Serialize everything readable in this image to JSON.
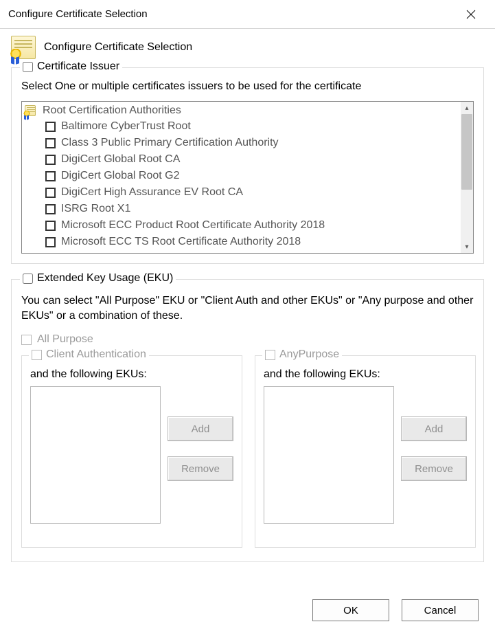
{
  "window": {
    "title": "Configure Certificate Selection"
  },
  "header": {
    "title": "Configure Certificate Selection"
  },
  "issuer_group": {
    "legend": "Certificate Issuer",
    "description": "Select One or multiple certificates issuers to be used for the certificate",
    "root_label": "Root Certification Authorities",
    "items": [
      {
        "label": "Baltimore CyberTrust Root",
        "checked": false
      },
      {
        "label": "Class 3 Public Primary Certification Authority",
        "checked": false
      },
      {
        "label": "DigiCert Global Root CA",
        "checked": false
      },
      {
        "label": "DigiCert Global Root G2",
        "checked": false
      },
      {
        "label": "DigiCert High Assurance EV Root CA",
        "checked": false
      },
      {
        "label": "ISRG Root X1",
        "checked": false
      },
      {
        "label": "Microsoft ECC Product Root Certificate Authority 2018",
        "checked": false
      },
      {
        "label": "Microsoft ECC TS Root Certificate Authority 2018",
        "checked": false
      }
    ]
  },
  "eku_group": {
    "legend": "Extended Key Usage (EKU)",
    "description": "You can select \"All Purpose\" EKU or \"Client Auth and other EKUs\" or \"Any purpose and other EKUs\" or a combination of these.",
    "all_purpose_label": "All Purpose",
    "left": {
      "legend": "Client Authentication",
      "subtitle": "and the following EKUs:",
      "add_label": "Add",
      "remove_label": "Remove"
    },
    "right": {
      "legend": "AnyPurpose",
      "subtitle": "and the following EKUs:",
      "add_label": "Add",
      "remove_label": "Remove"
    }
  },
  "footer": {
    "ok": "OK",
    "cancel": "Cancel"
  }
}
